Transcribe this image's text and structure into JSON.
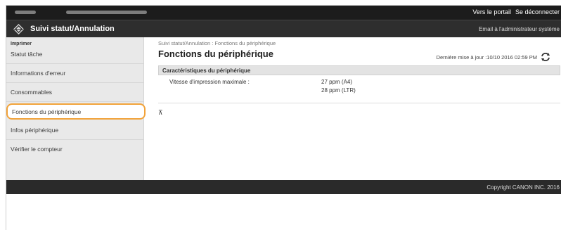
{
  "topbar": {
    "portal_link": "Vers le portail",
    "logout_link": "Se déconnecter"
  },
  "header": {
    "app_title": "Suivi statut/Annulation",
    "admin_mail": "Email à l'administrateur système"
  },
  "sidebar": {
    "section_title": "Imprimer",
    "items": [
      {
        "label": "Statut tâche"
      },
      {
        "label": "Informations d'erreur"
      },
      {
        "label": "Consommables"
      },
      {
        "label": "Fonctions du périphérique"
      },
      {
        "label": "Infos périphérique"
      },
      {
        "label": "Vérifier le compteur"
      }
    ]
  },
  "main": {
    "breadcrumb": "Suivi statut/Annulation : Fonctions du périphérique",
    "page_title": "Fonctions du périphérique",
    "last_update": "Dernière mise à jour :10/10 2016 02:59 PM",
    "panel_title": "Caractéristiques du périphérique",
    "speed_label": "Vitesse d'impression maximale :",
    "speed_a4": "27 ppm (A4)",
    "speed_ltr": "28 ppm (LTR)",
    "top_icon": "⊼"
  },
  "footer": {
    "copyright": "Copyright CANON INC. 2016"
  },
  "colors": {
    "active_outline": "#f2a33a",
    "topbar": "#1c1c1c",
    "header": "#2e2e2e"
  }
}
